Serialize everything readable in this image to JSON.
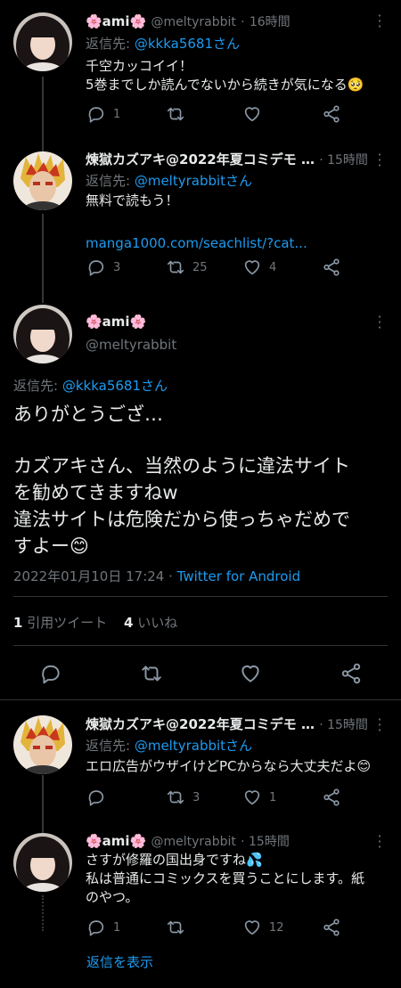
{
  "tweet1": {
    "name": "🌸ami🌸",
    "handle": "@meltyrabbit",
    "time": "16時間",
    "reply_prefix": "返信先: ",
    "reply_to": "@kkka5681さん",
    "line1": "千空カッコイイ！",
    "line2": "5巻までしか読んでないから続きが気になる🥺",
    "replies": "1",
    "retweets": "",
    "likes": ""
  },
  "tweet2": {
    "name": "煉獄カズアキ@2022年夏コミデモ …",
    "time": "· 15時間",
    "reply_prefix": "返信先: ",
    "reply_to": "@meltyrabbitさん",
    "line1": "無料で読もう！",
    "link": "manga1000.com/seachlist/?cat...",
    "replies": "3",
    "retweets": "25",
    "likes": "4"
  },
  "main": {
    "name": "🌸ami🌸",
    "handle": "@meltyrabbit",
    "reply_prefix": "返信先: ",
    "reply_to": "@kkka5681さん",
    "line1": "ありがとうござ…",
    "line2": "カズアキさん、当然のように違法サイト",
    "line3": "を勧めてきますねw",
    "line4": "違法サイトは危険だから使っちゃだめで",
    "line5": "すよー😊",
    "date": "2022年01月10日 17:24 · ",
    "client": "Twitter for Android",
    "rt_count": "1",
    "rt_label": " 引用ツイート",
    "like_count": "4",
    "like_label": " いいね"
  },
  "tweet3": {
    "name": "煉獄カズアキ@2022年夏コミデモ …",
    "time": "· 15時間",
    "reply_prefix": "返信先: ",
    "reply_to": "@meltyrabbitさん",
    "line1": "エロ広告がウザイけどPCからなら大丈夫だよ😊",
    "replies": "",
    "retweets": "3",
    "likes": "1"
  },
  "tweet4": {
    "name": "🌸ami🌸",
    "handle": "@meltyrabbit",
    "time": "· 15時間",
    "line1": "さすが修羅の国出身ですね💦",
    "line2": "私は普通にコミックスを買うことにします。紙",
    "line3": "のやつ。",
    "replies": "1",
    "retweets": "",
    "likes": "12"
  },
  "show_replies": "返信を表示",
  "colors": {
    "link": "#1d9bf0",
    "muted": "#71767b",
    "background": "#000000"
  }
}
